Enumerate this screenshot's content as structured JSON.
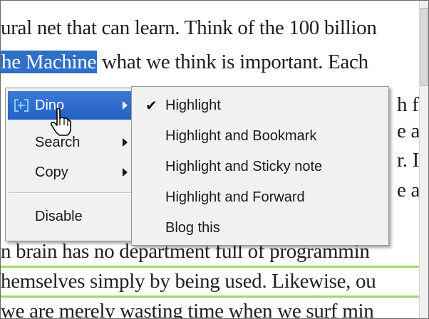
{
  "document": {
    "lines": [
      "ural net that can learn. Think of the 100 billion",
      "what we think is important. Each",
      "h fa",
      "e as",
      "r. It",
      "e a",
      "n brain has no department full of programmin",
      "hemselves simply by being used. Likewise, ou",
      "we are merely wasting time when we surf min"
    ],
    "highlighted_phrase": "he Machine",
    "line1_rest": " what we think is important. Each"
  },
  "context_menu": {
    "items": [
      {
        "label": "Dino",
        "has_submenu": true,
        "active": true
      },
      {
        "label": "Search",
        "has_submenu": true
      },
      {
        "label": "Copy",
        "has_submenu": true
      },
      {
        "label": "Disable",
        "has_submenu": false
      }
    ]
  },
  "submenu": {
    "items": [
      {
        "label": "Highlight",
        "checked": true
      },
      {
        "label": "Highlight and Bookmark"
      },
      {
        "label": "Highlight and Sticky note"
      },
      {
        "label": "Highlight and Forward"
      },
      {
        "label": "Blog this"
      }
    ]
  },
  "colors": {
    "selection": "#2f6fc5",
    "menu_active": "#2f6ccb",
    "rule": "#9fd86b"
  },
  "icons": {
    "dino": "dino-icon",
    "check": "checkmark-icon",
    "cursor": "hand-cursor-icon"
  }
}
